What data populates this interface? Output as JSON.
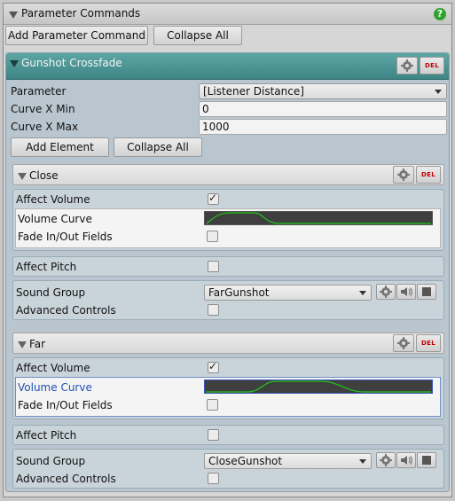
{
  "header": {
    "title": "Parameter Commands"
  },
  "toolbar": {
    "add_label": "Add Parameter Command",
    "collapse_label": "Collapse All"
  },
  "group": {
    "title": "Gunshot Crossfade",
    "del_label": "DEL",
    "parameter": {
      "label": "Parameter",
      "value": "[Listener Distance]"
    },
    "curve_x_min": {
      "label": "Curve X Min",
      "value": "0"
    },
    "curve_x_max": {
      "label": "Curve X Max",
      "value": "1000"
    },
    "add_element_label": "Add Element",
    "collapse_all_label": "Collapse All"
  },
  "elements": [
    {
      "title": "Close",
      "del_label": "DEL",
      "affect_volume": {
        "label": "Affect Volume",
        "checked": true
      },
      "volume_curve": {
        "label": "Volume Curve"
      },
      "fade_fields": {
        "label": "Fade In/Out Fields",
        "checked": false
      },
      "affect_pitch": {
        "label": "Affect Pitch",
        "checked": false
      },
      "sound_group": {
        "label": "Sound Group",
        "value": "FarGunshot"
      },
      "advanced_controls": {
        "label": "Advanced Controls",
        "checked": false
      }
    },
    {
      "title": "Far",
      "del_label": "DEL",
      "affect_volume": {
        "label": "Affect Volume",
        "checked": true
      },
      "volume_curve": {
        "label": "Volume Curve"
      },
      "fade_fields": {
        "label": "Fade In/Out Fields",
        "checked": false
      },
      "affect_pitch": {
        "label": "Affect Pitch",
        "checked": false
      },
      "sound_group": {
        "label": "Sound Group",
        "value": "CloseGunshot"
      },
      "advanced_controls": {
        "label": "Advanced Controls",
        "checked": false
      }
    }
  ],
  "icons": {
    "help": "help-icon",
    "gear": "gear-icon",
    "speaker": "speaker-icon",
    "stop": "stop-icon",
    "foldout": "foldout-triangle-icon"
  },
  "colors": {
    "group_header": "#4a9494",
    "curve_bg": "#3f3f3f",
    "curve_line": "#1ec81e",
    "help": "#2ea12e",
    "del_text": "#c00000"
  },
  "checkmark": "✓"
}
